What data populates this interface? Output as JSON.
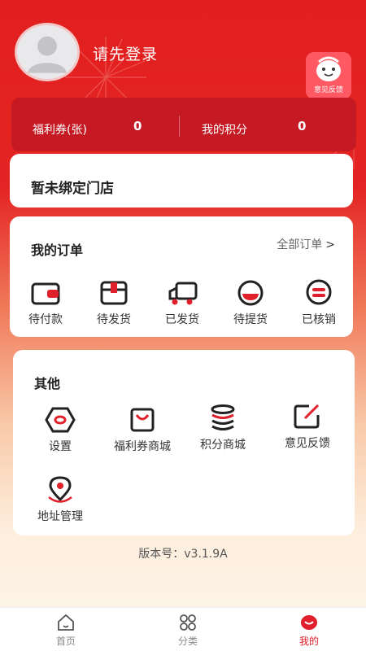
{
  "profile": {
    "login_prompt": "请先登录"
  },
  "feedback_badge": {
    "label": "意见反馈"
  },
  "stats": {
    "coupons_label": "福利券(张)",
    "coupons_value": "0",
    "points_label": "我的积分",
    "points_value": "0"
  },
  "store": {
    "text": "暂未绑定门店"
  },
  "orders": {
    "title": "我的订单",
    "all_label": "全部订单",
    "items": [
      {
        "label": "待付款",
        "icon": "wallet-icon"
      },
      {
        "label": "待发货",
        "icon": "box-icon"
      },
      {
        "label": "已发货",
        "icon": "truck-icon"
      },
      {
        "label": "待提货",
        "icon": "bowl-icon"
      },
      {
        "label": "已核销",
        "icon": "ticket-icon"
      }
    ]
  },
  "other": {
    "title": "其他",
    "items": [
      {
        "label": "设置",
        "icon": "settings-icon"
      },
      {
        "label": "福利券商城",
        "icon": "shopping-bag-icon"
      },
      {
        "label": "积分商城",
        "icon": "coin-stack-icon"
      },
      {
        "label": "意见反馈",
        "icon": "edit-icon"
      },
      {
        "label": "地址管理",
        "icon": "location-pin-icon"
      }
    ]
  },
  "version": {
    "text": "版本号：v3.1.9A"
  },
  "tabbar": {
    "items": [
      {
        "label": "首页",
        "icon": "home-icon",
        "active": false
      },
      {
        "label": "分类",
        "icon": "category-icon",
        "active": false
      },
      {
        "label": "我的",
        "icon": "profile-icon",
        "active": true
      }
    ]
  },
  "colors": {
    "brand_red": "#e21f1f",
    "stats_red": "#c51a23",
    "active_tab": "#e0202a"
  }
}
